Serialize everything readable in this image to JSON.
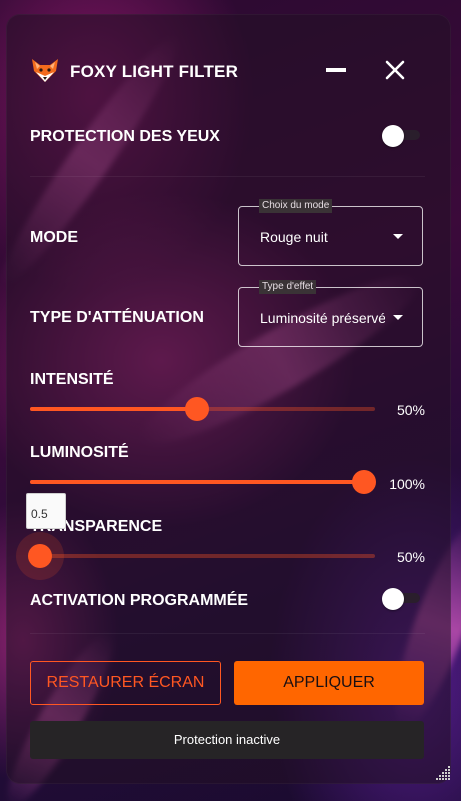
{
  "app": {
    "title": "FOXY LIGHT FILTER",
    "logo_icon": "fox-logo-icon",
    "minimize_icon": "minimize-icon",
    "close_icon": "close-icon"
  },
  "eye_protection": {
    "label": "PROTECTION DES YEUX",
    "enabled": false
  },
  "mode": {
    "label": "MODE",
    "legend": "Choix du mode",
    "value": "Rouge nuit"
  },
  "dimming_type": {
    "label": "TYPE D'ATTÉNUATION",
    "legend": "Type d'effet",
    "value": "Luminosité préservée"
  },
  "intensity": {
    "label": "INTENSITÉ",
    "value": 0.5,
    "display": "50%"
  },
  "brightness": {
    "label": "LUMINOSITÉ",
    "value": 1.0,
    "display": "100%"
  },
  "transparency": {
    "label": "TRANSPARENCE",
    "value": 0.5,
    "display": "50%",
    "tooltip": "0.5"
  },
  "scheduled": {
    "label": "ACTIVATION PROGRAMMÉE",
    "enabled": false
  },
  "buttons": {
    "restore": "RESTAURER ÉCRAN",
    "apply": "APPLIQUER"
  },
  "status": {
    "text": "Protection inactive"
  },
  "colors": {
    "accent": "#ff5722",
    "apply_bg": "#ff6600"
  }
}
